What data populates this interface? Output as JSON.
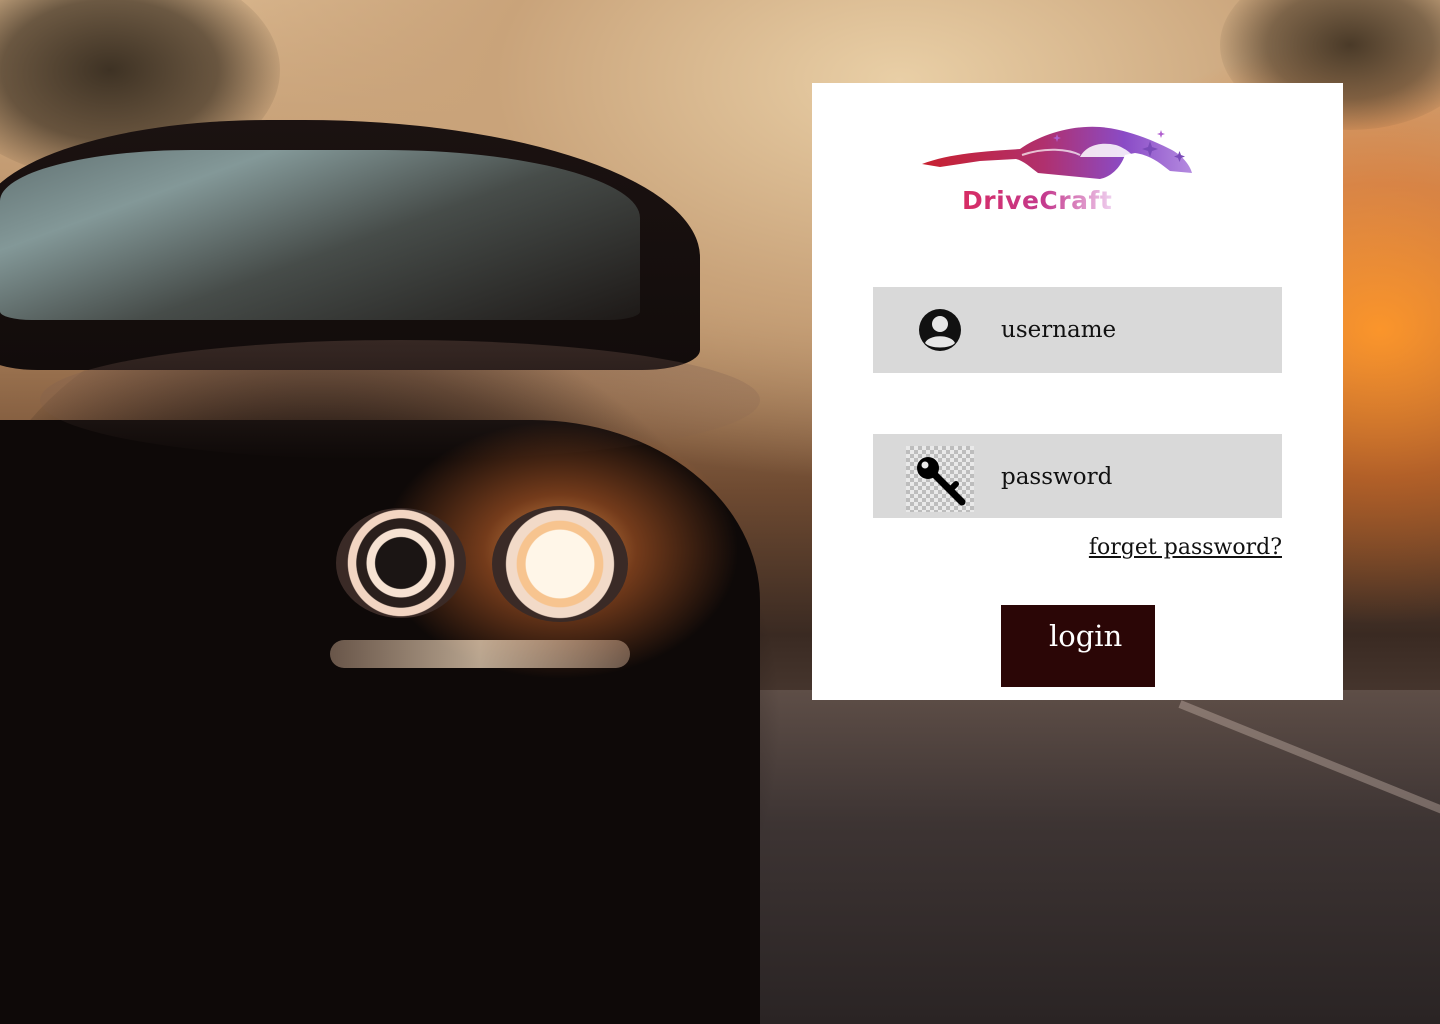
{
  "brand": {
    "name": "DriveCraft"
  },
  "form": {
    "username": {
      "placeholder": "username",
      "icon": "user-icon"
    },
    "password": {
      "placeholder": "password",
      "icon": "key-icon"
    },
    "forget_password_label": "forget password?",
    "login_label": "login"
  },
  "colors": {
    "panel_background": "#ffffff",
    "field_background": "#d9d9d9",
    "login_button_background": "#2b0606",
    "brand_gradient_start": "#d72c63",
    "brand_gradient_end": "#c43a8e"
  }
}
